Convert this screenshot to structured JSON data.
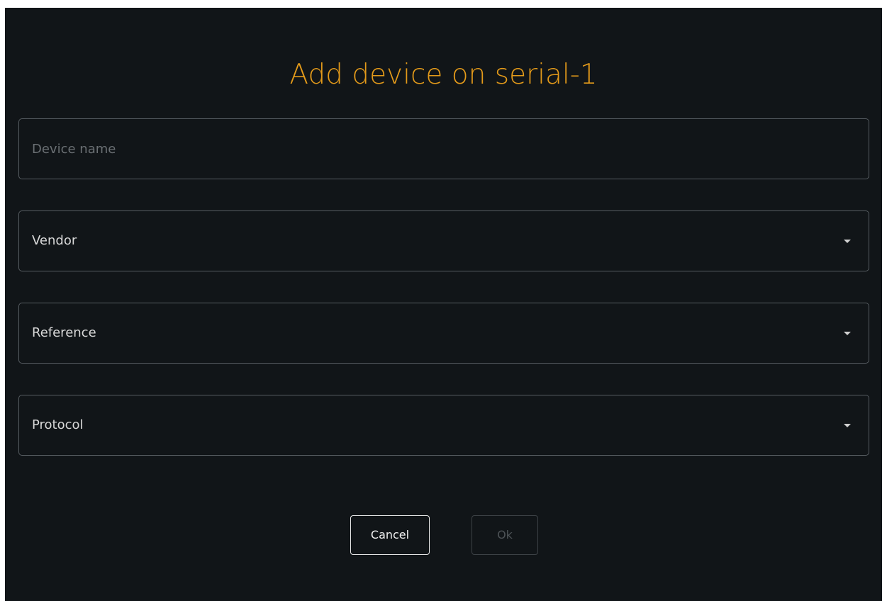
{
  "dialog": {
    "title": "Add device on serial-1",
    "device_name": {
      "value": "",
      "placeholder": "Device name"
    },
    "vendor": {
      "label": "Vendor",
      "icon": "caret-down-icon"
    },
    "reference": {
      "label": "Reference",
      "icon": "caret-down-icon"
    },
    "protocol": {
      "label": "Protocol",
      "icon": "caret-down-icon"
    },
    "buttons": {
      "cancel": "Cancel",
      "ok": "Ok"
    }
  },
  "colors": {
    "background": "#111518",
    "title": "#e39a1a",
    "field_border": "#565c61",
    "disabled": "#4d5256"
  }
}
